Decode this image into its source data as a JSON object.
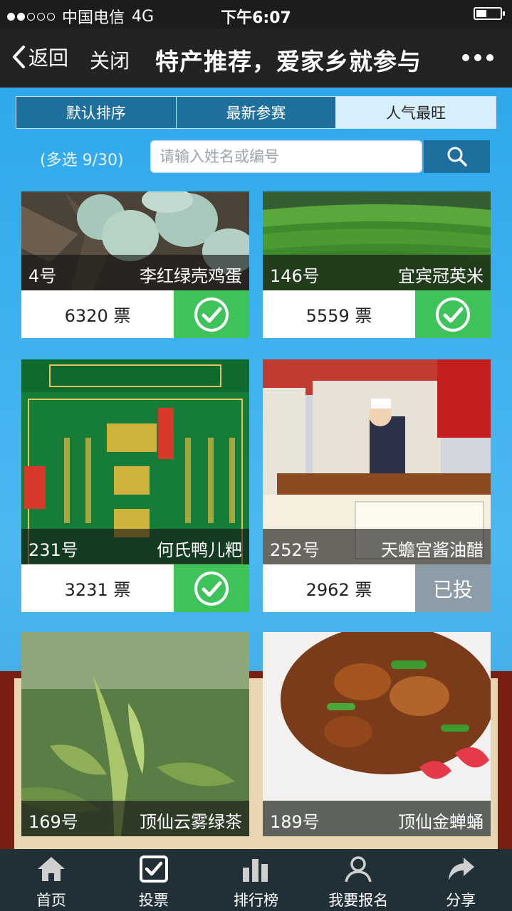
{
  "status_bar": {
    "carrier": "中国电信",
    "network": "4G",
    "time": "下午6:07"
  },
  "nav": {
    "back_label": "返回",
    "close_label": "关闭",
    "title": "特产推荐，爱家乡就参与"
  },
  "tabs": [
    {
      "label": "默认排序",
      "active": false
    },
    {
      "label": "最新参赛",
      "active": false
    },
    {
      "label": "人气最旺",
      "active": true
    }
  ],
  "multi_select": "(多选 9/30)",
  "search": {
    "placeholder": "请输入姓名或编号"
  },
  "entries": [
    {
      "number": "4号",
      "name": "李红绿壳鸡蛋",
      "votes": "6320 票",
      "voted": true
    },
    {
      "number": "146号",
      "name": "宜宾冠英米",
      "votes": "5559 票",
      "voted": true
    },
    {
      "number": "231号",
      "name": "何氏鸭儿粑",
      "votes": "3231 票",
      "voted": true
    },
    {
      "number": "252号",
      "name": "天蟾宫酱油醋",
      "votes": "2962 票",
      "voted_label": "已投"
    },
    {
      "number": "169号",
      "name": "顶仙云雾绿茶"
    },
    {
      "number": "189号",
      "name": "顶仙金蝉蛹"
    }
  ],
  "tabbar": [
    {
      "label": "首页",
      "icon": "home-icon"
    },
    {
      "label": "投票",
      "icon": "checkbox-icon"
    },
    {
      "label": "排行榜",
      "icon": "bar-chart-icon"
    },
    {
      "label": "我要报名",
      "icon": "user-icon"
    },
    {
      "label": "分享",
      "icon": "share-icon"
    }
  ]
}
